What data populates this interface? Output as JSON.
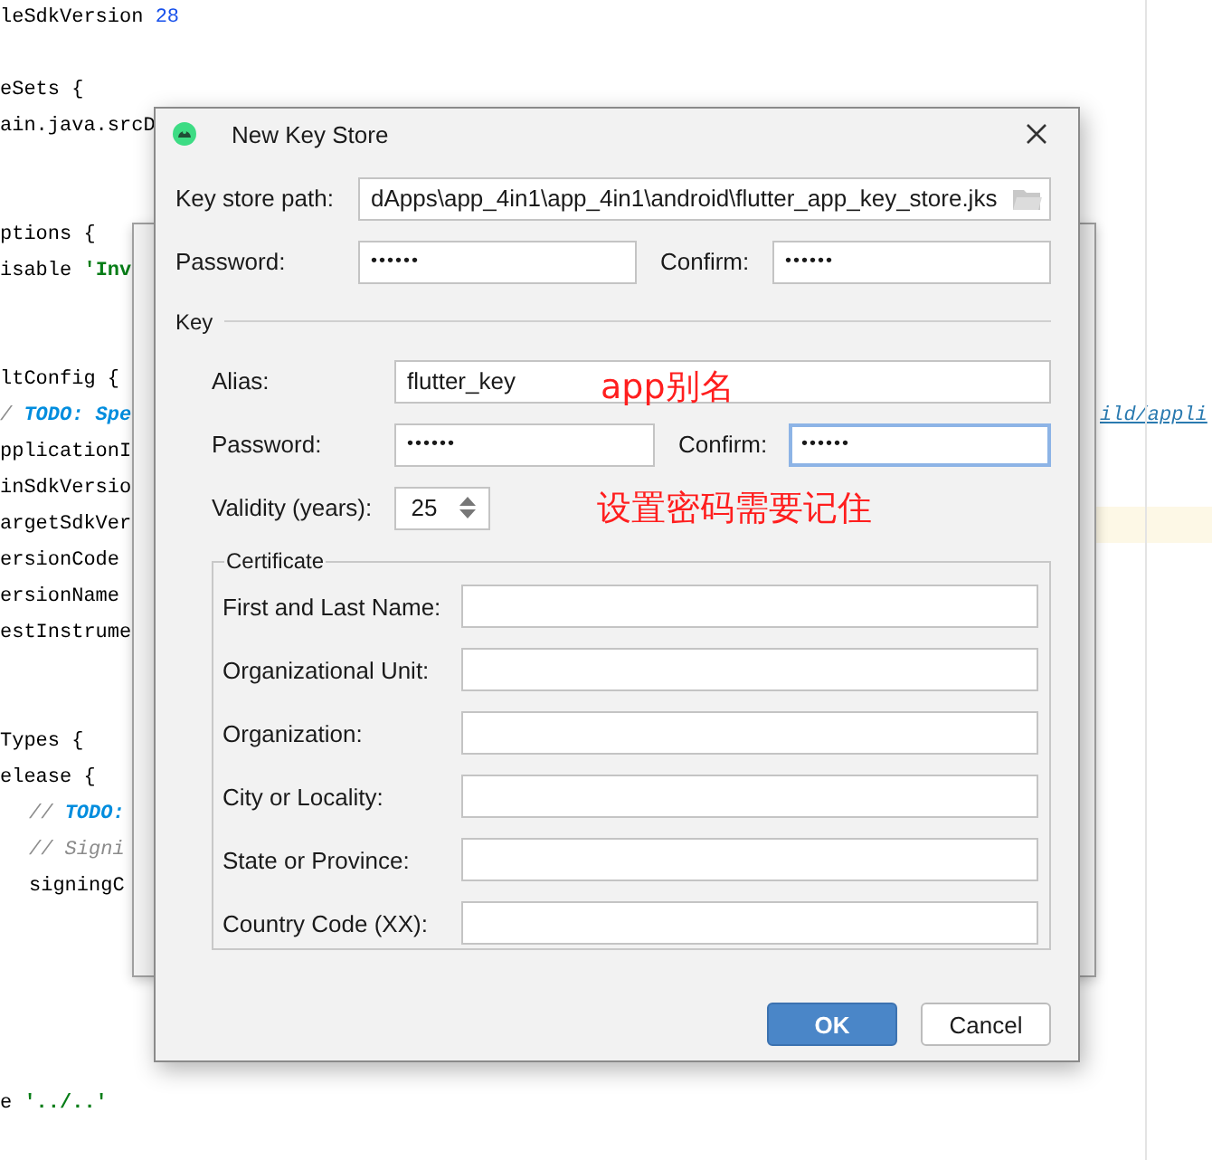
{
  "editor": {
    "lines": [
      {
        "kind": "code",
        "segments": [
          {
            "kind": "plain",
            "text": "leSdkVersion "
          },
          {
            "kind": "number",
            "text": "28"
          }
        ]
      },
      {
        "kind": "blank"
      },
      {
        "kind": "code",
        "segments": [
          {
            "kind": "plain",
            "text": "eSets {"
          }
        ]
      },
      {
        "kind": "code",
        "segments": [
          {
            "kind": "plain",
            "text": "ain.java.srcD"
          }
        ]
      },
      {
        "kind": "blank"
      },
      {
        "kind": "blank"
      },
      {
        "kind": "code",
        "segments": [
          {
            "kind": "plain",
            "text": "ptions {"
          }
        ]
      },
      {
        "kind": "code",
        "segments": [
          {
            "kind": "plain",
            "text": "isable "
          },
          {
            "kind": "string",
            "text": "'Inv"
          }
        ]
      },
      {
        "kind": "blank"
      },
      {
        "kind": "blank"
      },
      {
        "kind": "code",
        "segments": [
          {
            "kind": "plain",
            "text": "ltConfig {"
          }
        ]
      },
      {
        "kind": "code",
        "segments": [
          {
            "kind": "comment",
            "text": "/ "
          },
          {
            "kind": "todo",
            "text": "TODO: Spe"
          }
        ],
        "right": {
          "kind": "link",
          "text": "ild/appli"
        }
      },
      {
        "kind": "code",
        "segments": [
          {
            "kind": "plain",
            "text": "pplicationI"
          }
        ]
      },
      {
        "kind": "code",
        "segments": [
          {
            "kind": "plain",
            "text": "inSdkVersio"
          }
        ]
      },
      {
        "kind": "code",
        "segments": [
          {
            "kind": "plain",
            "text": "argetSdkVer"
          }
        ],
        "highlighted": true
      },
      {
        "kind": "code",
        "segments": [
          {
            "kind": "plain",
            "text": "ersionCode"
          }
        ]
      },
      {
        "kind": "code",
        "segments": [
          {
            "kind": "plain",
            "text": "ersionName"
          }
        ]
      },
      {
        "kind": "code",
        "segments": [
          {
            "kind": "plain",
            "text": "estInstrume"
          }
        ]
      },
      {
        "kind": "blank"
      },
      {
        "kind": "blank"
      },
      {
        "kind": "code",
        "segments": [
          {
            "kind": "plain",
            "text": "Types {"
          }
        ]
      },
      {
        "kind": "code",
        "segments": [
          {
            "kind": "plain",
            "text": "elease {"
          }
        ]
      },
      {
        "kind": "code",
        "indented": true,
        "segments": [
          {
            "kind": "comment",
            "text": "// "
          },
          {
            "kind": "todo",
            "text": "TODO:"
          }
        ]
      },
      {
        "kind": "code",
        "indented": true,
        "segments": [
          {
            "kind": "comment",
            "text": "// Signi"
          }
        ]
      },
      {
        "kind": "code",
        "indented": true,
        "segments": [
          {
            "kind": "plain",
            "text": "signingC"
          }
        ]
      },
      {
        "kind": "blank"
      },
      {
        "kind": "blank"
      },
      {
        "kind": "blank"
      },
      {
        "kind": "blank"
      },
      {
        "kind": "blank"
      },
      {
        "kind": "code",
        "segments": [
          {
            "kind": "plain",
            "text": "e "
          },
          {
            "kind": "string",
            "text": "'../..'"
          }
        ]
      }
    ]
  },
  "dialog": {
    "title": "New Key Store",
    "key_store_path": {
      "label": "Key store path:",
      "value": "dApps\\app_4in1\\app_4in1\\android\\flutter_app_key_store.jks"
    },
    "password": {
      "label": "Password:",
      "value": "••••••"
    },
    "confirm": {
      "label": "Confirm:",
      "value": "••••••"
    },
    "key": {
      "title": "Key",
      "alias": {
        "label": "Alias:",
        "value": "flutter_key",
        "focused": false
      },
      "password": {
        "label": "Password:",
        "value": "••••••",
        "focused": false
      },
      "confirm": {
        "label": "Confirm:",
        "value": "••••••",
        "focused": true
      },
      "validity": {
        "label": "Validity (years):",
        "value": "25"
      },
      "certificate": {
        "title": "Certificate",
        "fields": [
          {
            "label": "First and Last Name:"
          },
          {
            "label": "Organizational Unit:"
          },
          {
            "label": "Organization:"
          },
          {
            "label": "City or Locality:"
          },
          {
            "label": "State or Province:"
          },
          {
            "label": "Country Code (XX):"
          }
        ]
      }
    },
    "buttons": [
      {
        "label": "OK",
        "default": true
      },
      {
        "label": "Cancel",
        "default": false
      }
    ]
  },
  "annotations": [
    {
      "text": "app别名"
    },
    {
      "text": "设置密码需要记住"
    }
  ]
}
